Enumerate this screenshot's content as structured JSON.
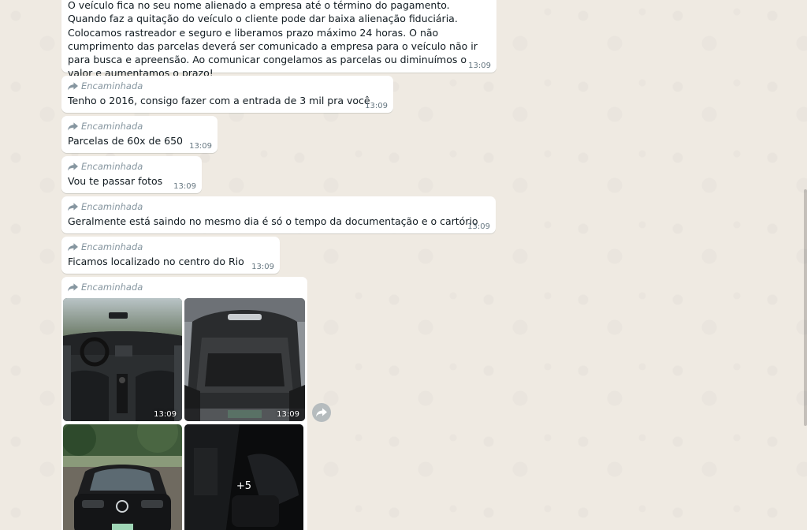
{
  "forward_label": "Encaminhada",
  "messages": [
    {
      "text": "O veículo fica no seu nome alienado a empresa até o término do pagamento. Quando faz a quitação do veículo o cliente pode dar baixa alienação fiduciária. Colocamos rastreador e seguro e liberamos prazo máximo 24 horas. O não cumprimento das parcelas deverá ser comunicado a empresa para o veículo não ir para busca e apreensão. Ao comunicar congelamos as parcelas ou diminuímos o valor e aumentamos o prazo!",
      "time": "13:09"
    },
    {
      "text": "Tenho o 2016, consigo fazer com a entrada de 3 mil pra você",
      "time": "13:09"
    },
    {
      "text": "Parcelas de 60x de 650",
      "time": "13:09"
    },
    {
      "text": "Vou te passar fotos",
      "time": "13:09"
    },
    {
      "text": "Geralmente está saindo no mesmo dia é só o tempo da documentação e o cartório",
      "time": "13:09"
    },
    {
      "text": "Ficamos localizado no centro do Rio",
      "time": "13:09"
    }
  ],
  "album": {
    "photos": [
      {
        "time": "13:09",
        "icon": "car-interior-photo"
      },
      {
        "time": "13:09",
        "icon": "car-trunk-photo"
      },
      {
        "icon": "car-front-photo"
      },
      {
        "icon": "car-door-photo",
        "more": "+5"
      }
    ]
  },
  "colors": {
    "background": "#efeae2",
    "bubble": "#ffffff",
    "meta": "#8696a0",
    "time": "#667781"
  }
}
